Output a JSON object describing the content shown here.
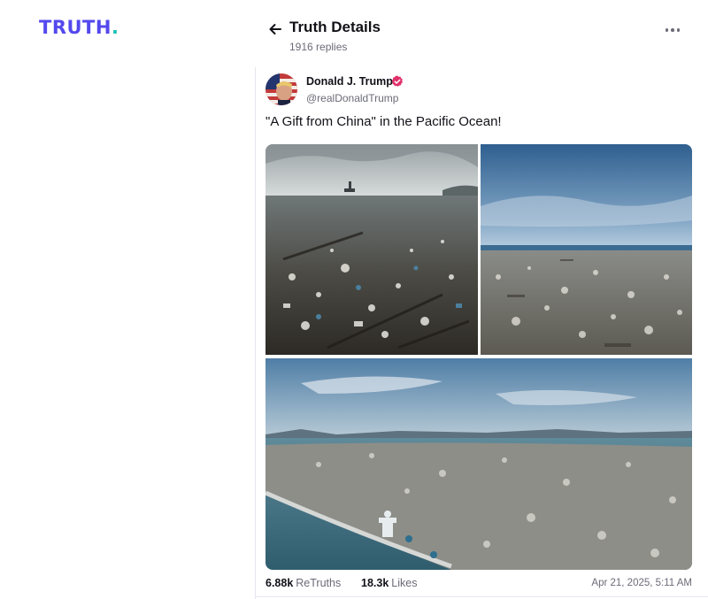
{
  "brand": {
    "logo_text": "TRUTH",
    "logo_dot": ".",
    "logo_color": "#5448ee",
    "dot_color": "#17c3b2"
  },
  "header": {
    "title": "Truth Details",
    "reply_count": "1916 replies",
    "back_icon": "arrow-left-icon",
    "more_icon": "ellipsis-icon"
  },
  "post": {
    "author_name": "Donald J. Trump",
    "author_handle": "@realDonaldTrump",
    "verified_icon": "verified-badge-icon",
    "verified_color": "#e0316b",
    "text": "\"A Gift from China\" in the Pacific Ocean!",
    "media": [
      {
        "description": "ocean-debris-photo-1"
      },
      {
        "description": "ocean-debris-photo-2"
      },
      {
        "description": "ocean-debris-photo-3"
      }
    ]
  },
  "stats": {
    "retruths_count": "6.88k",
    "retruths_label": "ReTruths",
    "likes_count": "18.3k",
    "likes_label": "Likes",
    "timestamp": "Apr 21, 2025, 5:11 AM"
  }
}
